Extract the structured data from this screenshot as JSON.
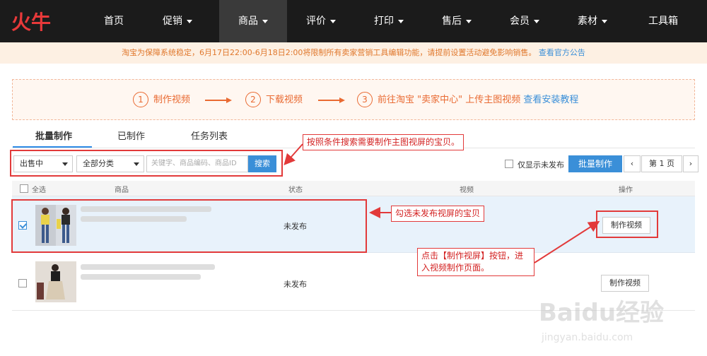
{
  "brand": {
    "logo_text": "火牛"
  },
  "nav": {
    "items": [
      {
        "label": "首页",
        "dropdown": false
      },
      {
        "label": "促销",
        "dropdown": true
      },
      {
        "label": "商品",
        "dropdown": true
      },
      {
        "label": "评价",
        "dropdown": true
      },
      {
        "label": "打印",
        "dropdown": true
      },
      {
        "label": "售后",
        "dropdown": true
      },
      {
        "label": "会员",
        "dropdown": true
      },
      {
        "label": "素材",
        "dropdown": true
      },
      {
        "label": "工具箱",
        "dropdown": false
      }
    ],
    "active": "商品"
  },
  "notice": {
    "text": "淘宝为保障系统稳定，6月17日22:00-6月18日2:00将限制所有卖家营销工具编辑功能，请提前设置活动避免影响销售。",
    "link": "查看官方公告"
  },
  "steps": [
    {
      "num": "1",
      "label": "制作视频"
    },
    {
      "num": "2",
      "label": "下载视频"
    },
    {
      "num": "3",
      "label": "前往淘宝 \"卖家中心\" 上传主图视频",
      "link": "查看安装教程"
    }
  ],
  "tabs": [
    {
      "label": "批量制作",
      "active": true
    },
    {
      "label": "已制作",
      "active": false
    },
    {
      "label": "任务列表",
      "active": false
    }
  ],
  "filters": {
    "status_select": "出售中",
    "category_select": "全部分类",
    "search_placeholder": "关键字、商品编码、商品ID",
    "search_button": "搜索",
    "only_unpublished": "仅显示未发布",
    "batch_button": "批量制作"
  },
  "pager": {
    "prev": "‹",
    "page": "第 1 页",
    "next": "›"
  },
  "table": {
    "headers": {
      "select_all": "全选",
      "product": "商品",
      "status": "状态",
      "video": "视频",
      "action": "操作"
    },
    "rows": [
      {
        "status": "未发布",
        "action": "制作视频",
        "checked": true
      },
      {
        "status": "未发布",
        "action": "制作视频",
        "checked": false
      }
    ]
  },
  "annotations": {
    "search_tip": "按照条件搜索需要制作主图视屏的宝贝。",
    "select_tip": "勾选未发布视屏的宝贝",
    "click_tip": "点击【制作视屏】按钮，进入视频制作页面。"
  },
  "watermark": {
    "text": "Baidu经验",
    "sub": "jingyan.baidu.com"
  },
  "colors": {
    "nav_bg": "#1b1b1b",
    "accent": "#3a8fd8",
    "orange": "#e96a32",
    "annotation_red": "#e23a3a"
  }
}
